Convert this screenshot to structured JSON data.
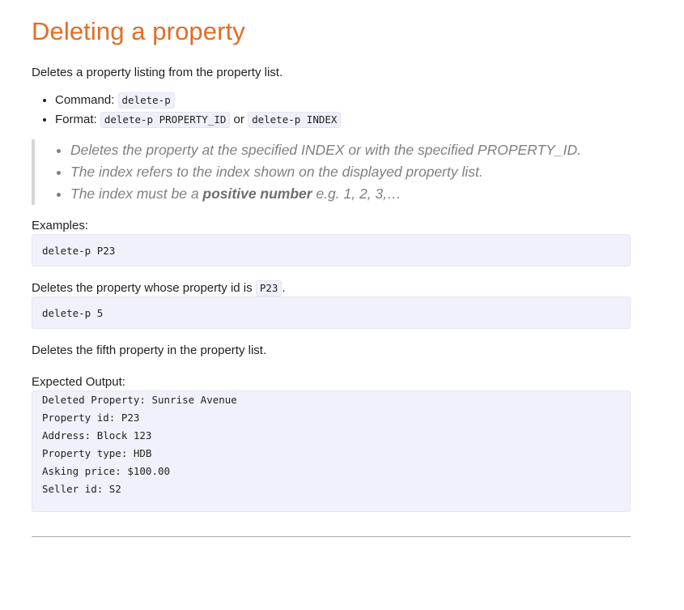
{
  "title": "Deleting a property",
  "description": "Deletes a property listing from the property list.",
  "command": {
    "label": "Command:",
    "code": "delete-p"
  },
  "format": {
    "label": "Format:",
    "code1": "delete-p PROPERTY_ID",
    "connector": "or",
    "code2": "delete-p INDEX"
  },
  "notes": {
    "item1": "Deletes the property at the specified INDEX or with the specified PROPERTY_ID.",
    "item2": "The index refers to the index shown on the displayed property list.",
    "item3_prefix": "The index must be a ",
    "item3_bold": "positive number",
    "item3_suffix": " e.g. 1, 2, 3,…"
  },
  "examples_label": "Examples:",
  "example1": {
    "code": "delete-p P23",
    "desc_prefix": "Deletes the property whose property id is ",
    "desc_code": "P23",
    "desc_suffix": "."
  },
  "example2": {
    "code": "delete-p 5",
    "desc": "Deletes the fifth property in the property list."
  },
  "expected_label": "Expected Output:",
  "output_lines": [
    "Deleted Property: Sunrise Avenue",
    "Property id: P23",
    "Address: Block 123",
    "Property type: HDB",
    "Asking price: $100.00",
    "Seller id: S2"
  ]
}
